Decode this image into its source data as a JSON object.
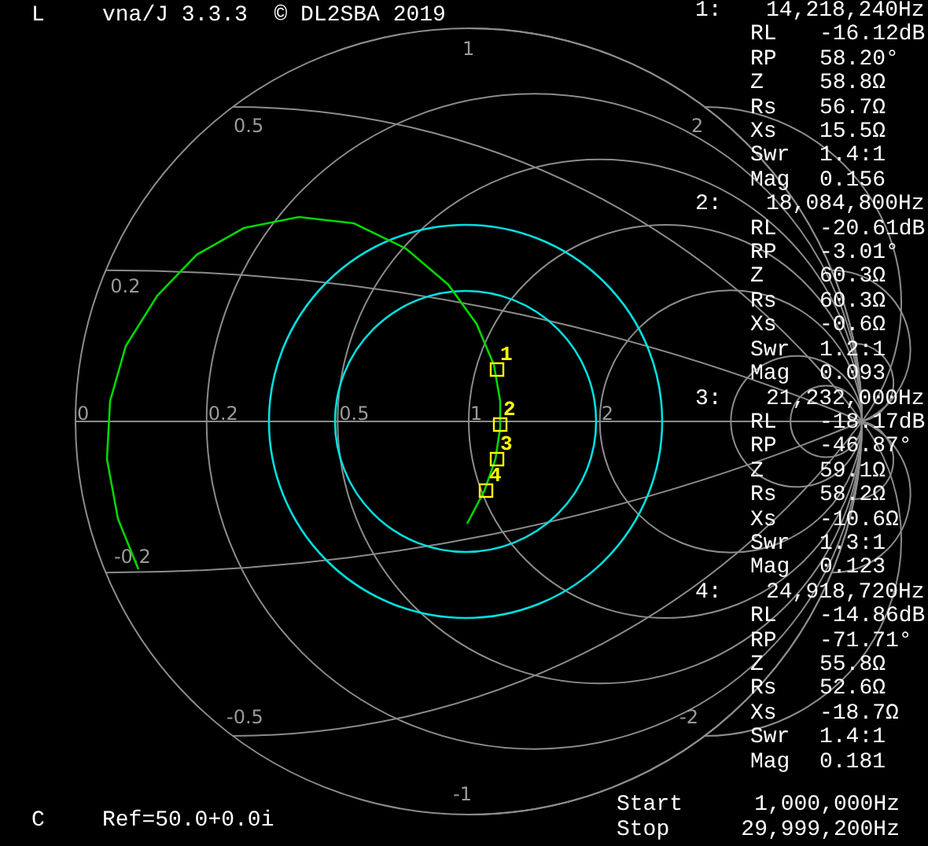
{
  "header": {
    "mode": "L",
    "title": "vna/J 3.3.3  © DL2SBA 2019"
  },
  "smith_chart": {
    "resistance_labels": [
      "0",
      "0.2",
      "0.5",
      "1",
      "2"
    ],
    "reactance_labels_upper": [
      "1",
      "0.5",
      "2",
      "0.2"
    ],
    "reactance_labels_lower": [
      "-0.2",
      "-0.5",
      "-2",
      "-1"
    ],
    "markers": [
      "1",
      "2",
      "3",
      "4"
    ]
  },
  "readouts": [
    {
      "index": "1:",
      "frequency": "14,218,240Hz",
      "rows": [
        {
          "label": "RL",
          "value": "-16.12dB"
        },
        {
          "label": "RP",
          "value": "58.20°"
        },
        {
          "label": "Z",
          "value": "58.8Ω"
        },
        {
          "label": "Rs",
          "value": "56.7Ω"
        },
        {
          "label": "Xs",
          "value": "15.5Ω"
        },
        {
          "label": "Swr",
          "value": "1.4:1"
        },
        {
          "label": "Mag",
          "value": "0.156"
        }
      ]
    },
    {
      "index": "2:",
      "frequency": "18,084,800Hz",
      "rows": [
        {
          "label": "RL",
          "value": "-20.61dB"
        },
        {
          "label": "RP",
          "value": "-3.01°"
        },
        {
          "label": "Z",
          "value": "60.3Ω"
        },
        {
          "label": "Rs",
          "value": "60.3Ω"
        },
        {
          "label": "Xs",
          "value": "-0.6Ω"
        },
        {
          "label": "Swr",
          "value": "1.2:1"
        },
        {
          "label": "Mag",
          "value": "0.093"
        }
      ]
    },
    {
      "index": "3:",
      "frequency": "21,232,000Hz",
      "rows": [
        {
          "label": "RL",
          "value": "-18.17dB"
        },
        {
          "label": "RP",
          "value": "-46.87°"
        },
        {
          "label": "Z",
          "value": "59.1Ω"
        },
        {
          "label": "Rs",
          "value": "58.2Ω"
        },
        {
          "label": "Xs",
          "value": "-10.6Ω"
        },
        {
          "label": "Swr",
          "value": "1.3:1"
        },
        {
          "label": "Mag",
          "value": "0.123"
        }
      ]
    },
    {
      "index": "4:",
      "frequency": "24,918,720Hz",
      "rows": [
        {
          "label": "RL",
          "value": "-14.86dB"
        },
        {
          "label": "RP",
          "value": "-71.71°"
        },
        {
          "label": "Z",
          "value": "55.8Ω"
        },
        {
          "label": "Rs",
          "value": "52.6Ω"
        },
        {
          "label": "Xs",
          "value": "-18.7Ω"
        },
        {
          "label": "Swr",
          "value": "1.4:1"
        },
        {
          "label": "Mag",
          "value": "0.181"
        }
      ]
    }
  ],
  "footer": {
    "mode": "C",
    "reference": "Ref=50.0+0.0i"
  },
  "sweep": [
    {
      "label": "Start",
      "value": "1,000,000Hz"
    },
    {
      "label": "Stop",
      "value": "29,999,200Hz"
    }
  ]
}
